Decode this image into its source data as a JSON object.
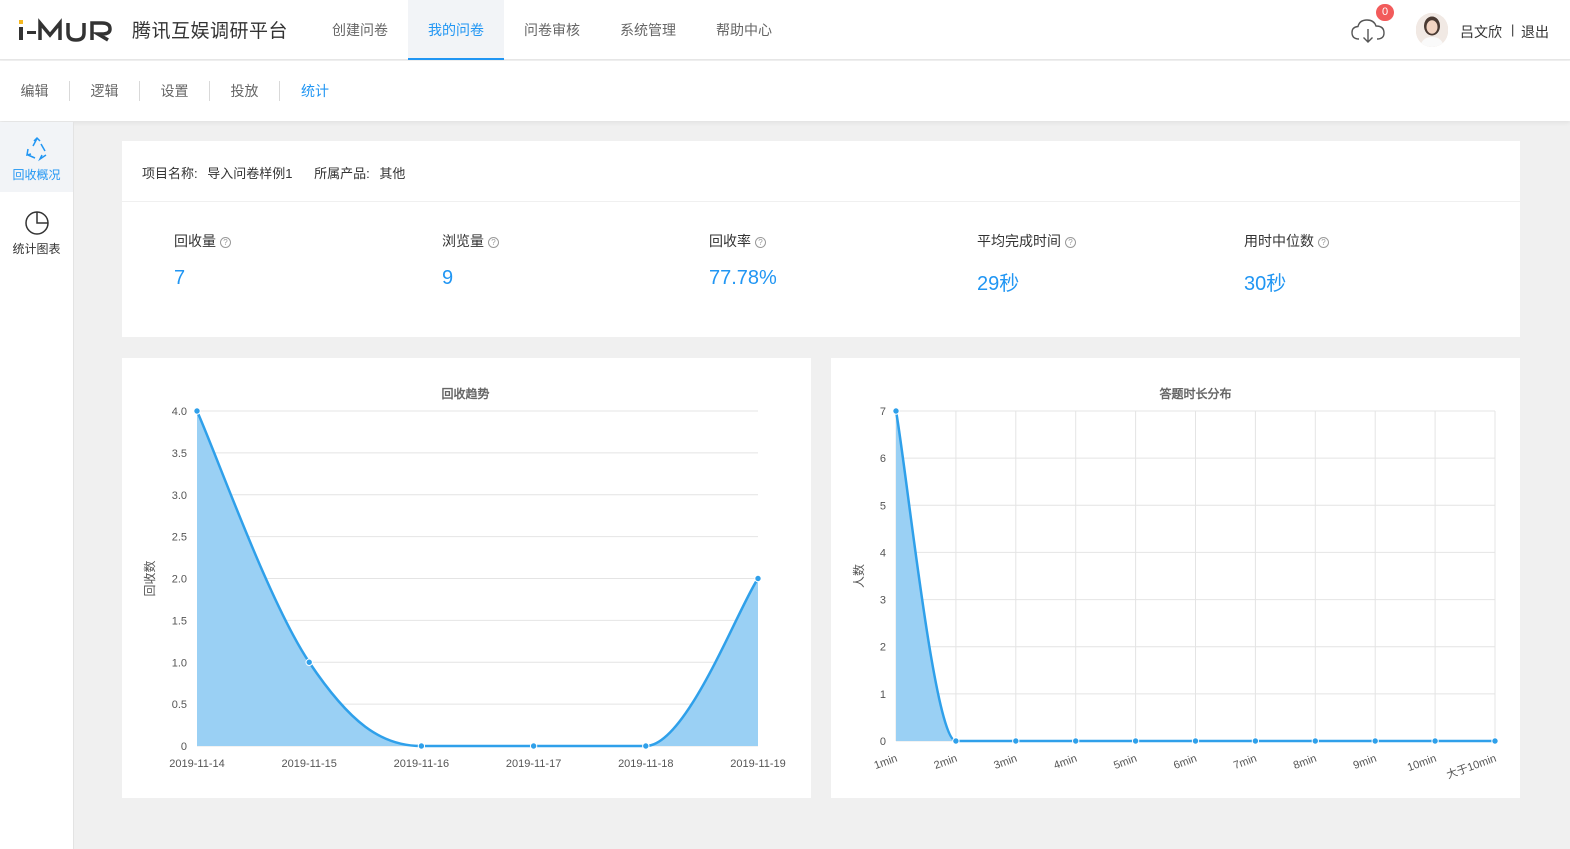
{
  "header": {
    "brand": "腾讯互娱调研平台",
    "nav": [
      {
        "label": "创建问卷",
        "active": false
      },
      {
        "label": "我的问卷",
        "active": true
      },
      {
        "label": "问卷审核",
        "active": false
      },
      {
        "label": "系统管理",
        "active": false
      },
      {
        "label": "帮助中心",
        "active": false
      }
    ],
    "download_count": "0",
    "username": "吕文欣",
    "separator": "|",
    "logout": "退出"
  },
  "subnav": [
    {
      "label": "编辑",
      "active": false
    },
    {
      "label": "逻辑",
      "active": false
    },
    {
      "label": "设置",
      "active": false
    },
    {
      "label": "投放",
      "active": false
    },
    {
      "label": "统计",
      "active": true
    }
  ],
  "sidebar": [
    {
      "label": "回收概况",
      "icon": "recycle-icon",
      "active": true
    },
    {
      "label": "统计图表",
      "icon": "pie-chart-icon",
      "active": false
    }
  ],
  "project": {
    "name_label": "项目名称:",
    "name_value": "导入问卷样例1",
    "product_label": "所属产品:",
    "product_value": "其他"
  },
  "stats": [
    {
      "label": "回收量",
      "value": "7"
    },
    {
      "label": "浏览量",
      "value": "9"
    },
    {
      "label": "回收率",
      "value": "77.78%"
    },
    {
      "label": "平均完成时间",
      "value": "29秒"
    },
    {
      "label": "用时中位数",
      "value": "30秒"
    }
  ],
  "accent_color": "#2196f3",
  "chart_data": [
    {
      "type": "area",
      "title": "回收趋势",
      "xlabel": "",
      "ylabel": "回收数",
      "categories": [
        "2019-11-14",
        "2019-11-15",
        "2019-11-16",
        "2019-11-17",
        "2019-11-18",
        "2019-11-19"
      ],
      "values": [
        4,
        1,
        0,
        0,
        0,
        2
      ],
      "ylim": [
        0,
        4
      ],
      "yticks": [
        "0",
        "0.5",
        "1.0",
        "1.5",
        "2.0",
        "2.5",
        "3.0",
        "3.5",
        "4.0"
      ],
      "grid": "horizontal",
      "color": "#2fa0ea",
      "fill": "#9ad0f4"
    },
    {
      "type": "area",
      "title": "答题时长分布",
      "xlabel": "",
      "ylabel": "人数",
      "categories": [
        "1min",
        "2min",
        "3min",
        "4min",
        "5min",
        "6min",
        "7min",
        "8min",
        "9min",
        "10min",
        "大于10min"
      ],
      "values": [
        7,
        0,
        0,
        0,
        0,
        0,
        0,
        0,
        0,
        0,
        0
      ],
      "ylim": [
        0,
        7
      ],
      "yticks": [
        "0",
        "1",
        "2",
        "3",
        "4",
        "5",
        "6",
        "7"
      ],
      "grid": "both",
      "color": "#2fa0ea",
      "fill": "#9ad0f4"
    }
  ]
}
